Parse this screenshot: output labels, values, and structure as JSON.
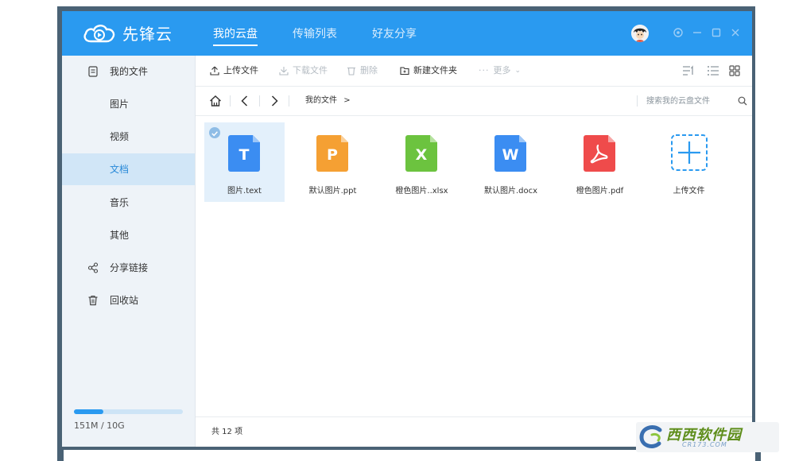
{
  "app": {
    "name": "先锋云",
    "tabs": [
      {
        "label": "我的云盘",
        "active": true
      },
      {
        "label": "传输列表",
        "active": false
      },
      {
        "label": "好友分享",
        "active": false
      }
    ],
    "window_controls": [
      "settings-icon",
      "minimize-icon",
      "maximize-icon",
      "close-icon"
    ]
  },
  "sidebar": {
    "items": [
      {
        "label": "我的文件",
        "icon": "document-icon"
      },
      {
        "label": "图片"
      },
      {
        "label": "视频"
      },
      {
        "label": "文档",
        "active": true
      },
      {
        "label": "音乐"
      },
      {
        "label": "其他"
      },
      {
        "label": "分享链接",
        "icon": "share-icon"
      },
      {
        "label": "回收站",
        "icon": "trash-icon"
      }
    ],
    "quota": {
      "used_fraction": 0.27,
      "text": "151M / 10G"
    }
  },
  "toolbar": {
    "upload": "上传文件",
    "download": "下载文件",
    "delete": "删除",
    "new_folder": "新建文件夹",
    "more": "更多"
  },
  "address": {
    "breadcrumb": "我的文件",
    "search_placeholder": "搜索我的云盘文件"
  },
  "files": [
    {
      "name": "图片.text",
      "letter": "T",
      "color": "#3b8df2",
      "selected": true
    },
    {
      "name": "默认图片.ppt",
      "letter": "P",
      "color": "#f5a033"
    },
    {
      "name": "橙色图片..xlsx",
      "letter": "X",
      "color": "#6cc33f"
    },
    {
      "name": "默认图片.docx",
      "letter": "W",
      "color": "#3b8df2"
    },
    {
      "name": "橙色图片.pdf",
      "letter": "pdf",
      "color": "#ef4b4b"
    },
    {
      "name": "上传文件",
      "letter": "+",
      "color": "#2a9af0",
      "upload": true
    }
  ],
  "status": {
    "count": "共 12 项"
  },
  "colors": {
    "accent": "#2a9af0",
    "sidebar_bg": "#eef3f8",
    "active_bg": "#d1e6f7"
  },
  "watermark": {
    "text": "西西软件园",
    "sub": "CR173.COM"
  }
}
